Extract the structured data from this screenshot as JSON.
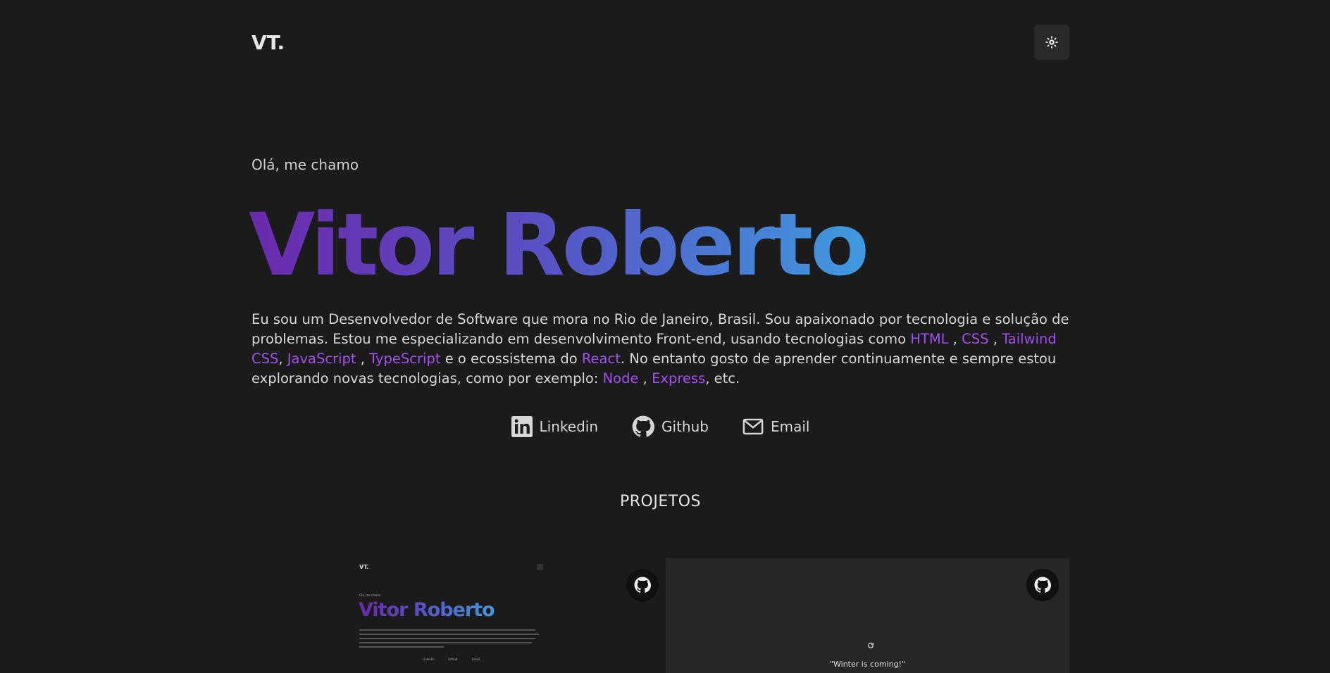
{
  "header": {
    "logo": "VT.",
    "theme_toggle_icon": "sun-icon"
  },
  "hero": {
    "greeting": "Olá, me chamo",
    "name": "Vitor Roberto",
    "bio": {
      "p1": "Eu sou um Desenvolvedor de Software que mora no Rio de Janeiro, Brasil. Sou apaixonado por tecnologia e solução de problemas. Estou me especializando em desenvolvimento Front-end, usando tecnologias como ",
      "html": "HTML",
      "sep1": " , ",
      "css": "CSS",
      "sep2": " , ",
      "tailwind": "Tailwind CSS",
      "sep3": ", ",
      "javascript": "JavaScript",
      "sep4": " , ",
      "typescript": "TypeScript",
      "p2": " e o ecossistema do ",
      "react": "React",
      "p3": ". No entanto gosto de aprender continuamente e sempre estou explorando novas tecnologias, como por exemplo: ",
      "node": "Node",
      "sep5": " , ",
      "express": "Express",
      "p4": ", etc."
    },
    "accent_color": "#a14ff0"
  },
  "socials": [
    {
      "label": "Linkedin",
      "icon": "linkedin-icon"
    },
    {
      "label": "Github",
      "icon": "github-icon"
    },
    {
      "label": "Email",
      "icon": "mail-icon"
    }
  ],
  "projects": {
    "title": "PROJETOS",
    "cards": [
      {
        "preview": {
          "logo": "VT.",
          "greeting": "Olá, me chamo",
          "name": "Vitor Roberto",
          "socials": [
            "Linkedin",
            "Github",
            "Email"
          ]
        },
        "link_icon": "github-icon"
      },
      {
        "quote": "\"Winter is coming!\"",
        "refresh_icon": "refresh-icon",
        "link_icon": "github-icon"
      }
    ]
  }
}
